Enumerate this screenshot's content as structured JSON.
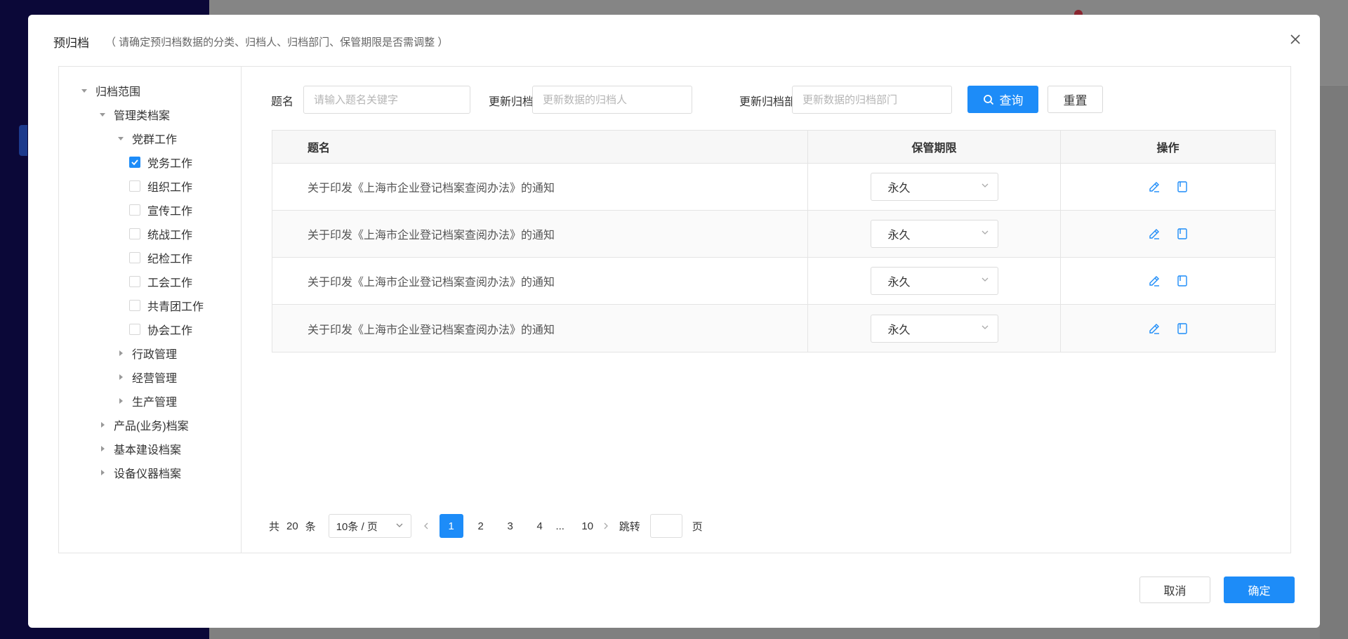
{
  "modal": {
    "title": "预归档",
    "subtitle": "（ 请确定预归档数据的分类、归档人、归档部门、保管期限是否需调整 ）"
  },
  "tree": {
    "root": "归档范围",
    "n1": "管理类档案",
    "n2": "党群工作",
    "leaves": [
      "党务工作",
      "组织工作",
      "宣传工作",
      "统战工作",
      "纪检工作",
      "工会工作",
      "共青团工作",
      "协会工作"
    ],
    "n2_siblings": [
      "行政管理",
      "经营管理",
      "生产管理"
    ],
    "n1_siblings": [
      "产品(业务)档案",
      "基本建设档案",
      "设备仪器档案"
    ]
  },
  "filter": {
    "title_label": "题名",
    "title_placeholder": "请输入题名关键字",
    "archiver_label": "更新归档人",
    "archiver_placeholder": "更新数据的归档人",
    "dept_label": "更新归档部门",
    "dept_placeholder": "更新数据的归档部门",
    "search_label": "查询",
    "reset_label": "重置"
  },
  "table": {
    "headers": [
      "题名",
      "保管期限",
      "操作"
    ],
    "rows": [
      {
        "title": "关于印发《上海市企业登记档案查阅办法》的通知",
        "period": "永久"
      },
      {
        "title": "关于印发《上海市企业登记档案查阅办法》的通知",
        "period": "永久"
      },
      {
        "title": "关于印发《上海市企业登记档案查阅办法》的通知",
        "period": "永久"
      },
      {
        "title": "关于印发《上海市企业登记档案查阅办法》的通知",
        "period": "永久"
      }
    ]
  },
  "pager": {
    "total_prefix": "共",
    "total": "20",
    "total_suffix": "条",
    "page_size": "10条 / 页",
    "pages": [
      "1",
      "2",
      "3",
      "4"
    ],
    "ellipsis": "...",
    "last_page": "10",
    "jump_label": "跳转",
    "page_suffix": "页"
  },
  "footer": {
    "cancel_label": "取消",
    "confirm_label": "确定"
  },
  "colors": {
    "primary": "#1d8cf8"
  }
}
